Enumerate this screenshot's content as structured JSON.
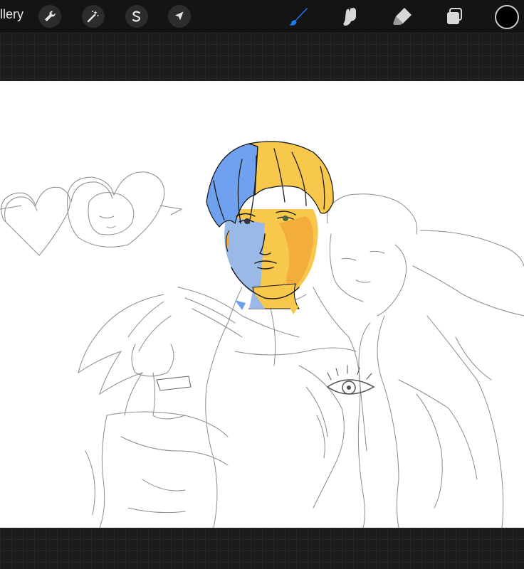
{
  "toolbar": {
    "gallery_label": "llery",
    "left_tools": [
      {
        "name": "wrench-icon"
      },
      {
        "name": "magic-wand-icon"
      },
      {
        "name": "selection-s-icon"
      },
      {
        "name": "move-arrow-icon"
      }
    ],
    "right_tools": [
      {
        "name": "brush-icon",
        "active": true
      },
      {
        "name": "smudge-icon"
      },
      {
        "name": "eraser-icon"
      },
      {
        "name": "layers-icon"
      }
    ],
    "current_color": "#000000",
    "active_tool_color": "#1a7cf5"
  }
}
